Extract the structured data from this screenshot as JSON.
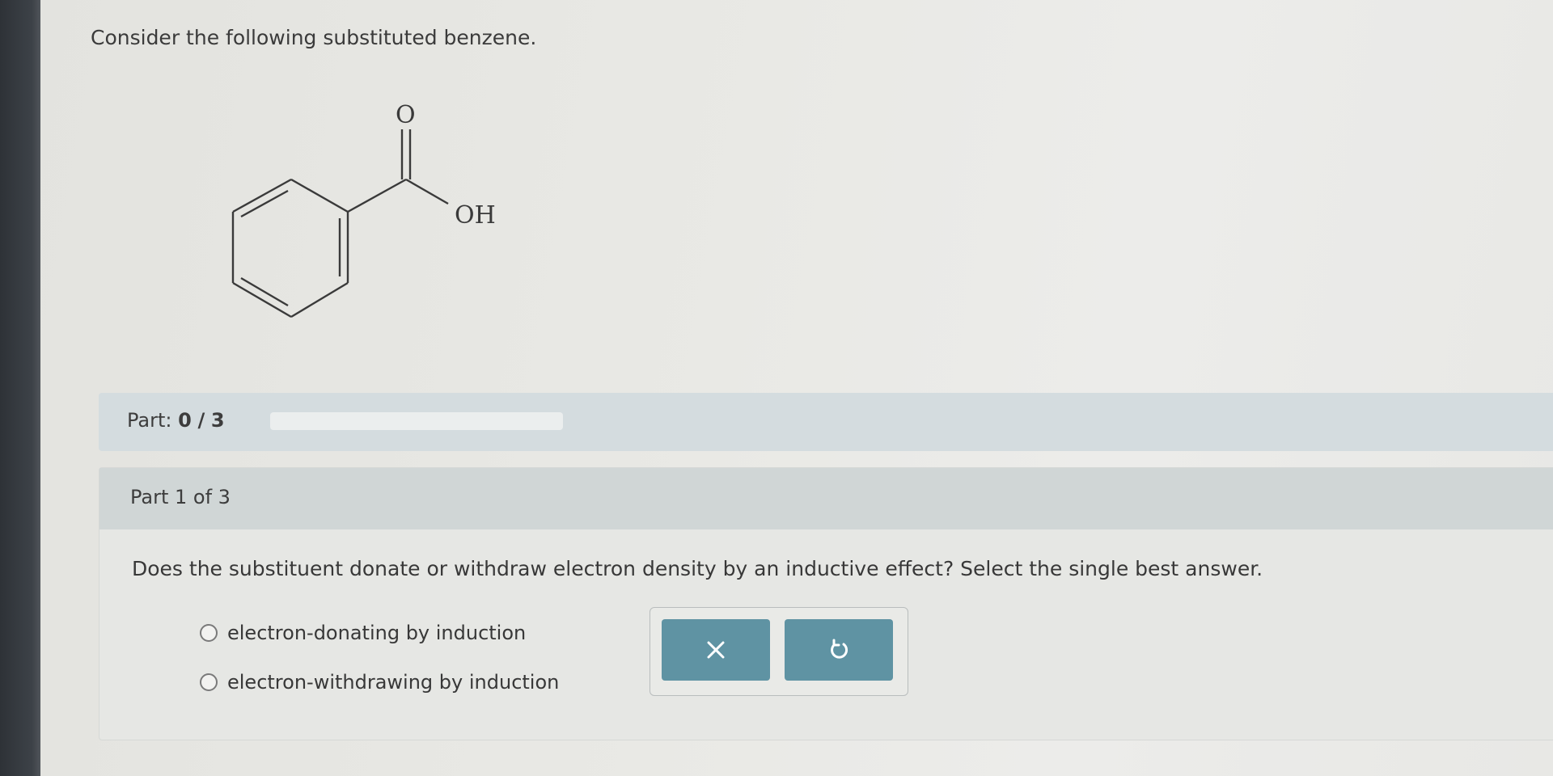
{
  "question": {
    "text": "Consider the following substituted benzene."
  },
  "molecule": {
    "labels": {
      "carbonyl_oxygen": "O",
      "hydroxyl": "OH"
    }
  },
  "progress": {
    "label": "Part:",
    "current": "0",
    "separator": "/",
    "total": "3",
    "fraction": 0.0
  },
  "part": {
    "title": "Part 1 of 3",
    "prompt": "Does the substituent donate or withdraw electron density by an inductive effect? Select the single best answer.",
    "choices": [
      {
        "label": "electron-donating by induction",
        "selected": false
      },
      {
        "label": "electron-withdrawing by induction",
        "selected": false
      }
    ]
  },
  "actions": {
    "clear_icon": "close-icon",
    "undo_icon": "undo-icon",
    "button_color": "#5f93a3"
  }
}
